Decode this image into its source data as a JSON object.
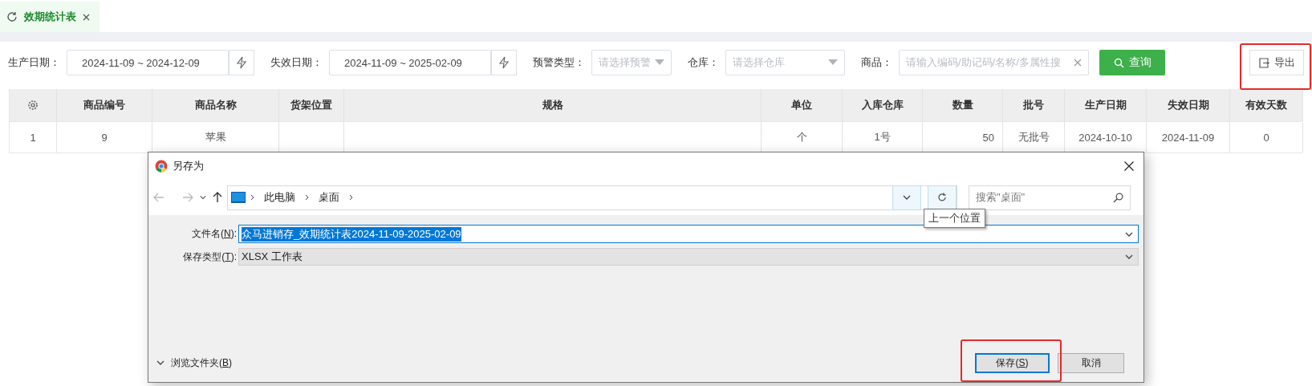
{
  "tabs": [
    {
      "label": "效期统计表",
      "selected": true
    }
  ],
  "filters": [
    {
      "kind": "date",
      "label": "生产日期：",
      "value": "2024-11-09 ~ 2024-12-09"
    },
    {
      "kind": "date",
      "label": "失效日期：",
      "value": "2024-11-09 ~ 2025-02-09"
    },
    {
      "kind": "select",
      "label": "预警类型：",
      "placeholder": "请选择预警"
    },
    {
      "kind": "select",
      "label": "仓库：",
      "placeholder": "请选择仓库"
    },
    {
      "kind": "search",
      "label": "商品：",
      "placeholder": "请输入编码/助记码/名称/多属性搜"
    }
  ],
  "query_button": "查询",
  "export_button": "导出",
  "table": {
    "columns": [
      "商品编号",
      "商品名称",
      "货架位置",
      "规格",
      "单位",
      "入库仓库",
      "数量",
      "批号",
      "生产日期",
      "失效日期",
      "有效天数"
    ],
    "rows": [
      {
        "index": "1",
        "cells": [
          "9",
          "苹果",
          "",
          "",
          "个",
          "1号",
          "50",
          "无批号",
          "2024-10-10",
          "2024-11-09",
          "0"
        ]
      }
    ]
  },
  "dialog": {
    "title": "另存为",
    "path": [
      "此电脑",
      "桌面"
    ],
    "search_placeholder": "搜索\"桌面\"",
    "tooltip": "上一个位置",
    "fields": [
      {
        "kind": "input",
        "label_parts": [
          "文件名(",
          "N",
          "):"
        ],
        "value": "众马进销存_效期统计表2024-11-09-2025-02-09",
        "selected": true
      },
      {
        "kind": "select",
        "label_parts": [
          "保存类型(",
          "T",
          "):"
        ],
        "value": "XLSX 工作表",
        "selected": false
      }
    ],
    "browse_parts": [
      "浏览文件夹(",
      "B",
      ")"
    ],
    "save_parts": [
      "保存(",
      "S",
      ")"
    ],
    "cancel": "取消"
  }
}
